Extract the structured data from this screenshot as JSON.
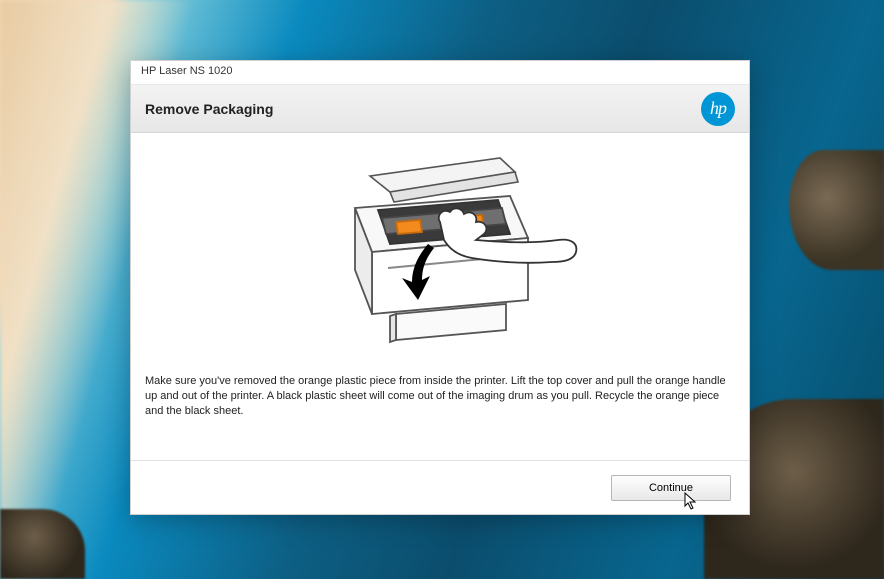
{
  "window": {
    "title": "HP Laser NS 1020"
  },
  "header": {
    "heading": "Remove Packaging",
    "logo_text": "hp"
  },
  "content": {
    "instruction": "Make sure you've removed the orange plastic piece from inside the printer. Lift the top cover and pull the orange handle up and out of the printer. A black plastic sheet will come out of the imaging drum as you pull. Recycle the orange piece and the black sheet."
  },
  "footer": {
    "continue_label": "Continue"
  }
}
